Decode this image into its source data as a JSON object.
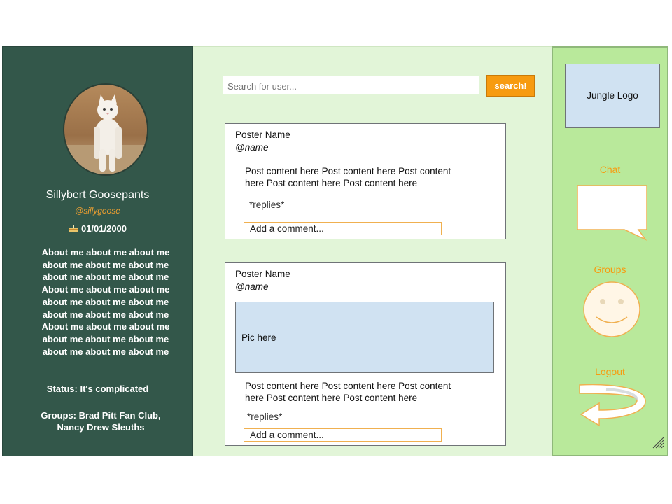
{
  "profile": {
    "display_name": "Sillybert Goosepants",
    "handle": "@sillygoose",
    "birthday": "01/01/2000",
    "about_lines": [
      "About me about me about me",
      "about me about me about me",
      "about me about me about me",
      "About me about me about me",
      "about me about me about me",
      "about me about me about me",
      "About me about me about me",
      "about me about me about me",
      "about me about me about me"
    ],
    "status": "Status: It's complicated",
    "groups_line1": "Groups: Brad Pitt Fan Club,",
    "groups_line2": "Nancy Drew Sleuths",
    "birthday_icon": "cake-icon"
  },
  "search": {
    "placeholder": "Search for user...",
    "button_label": "search!"
  },
  "posts": [
    {
      "poster_name": "Poster Name",
      "poster_handle": "@name",
      "content_line1": "Post content here Post content here Post content",
      "content_line2": "here Post content here Post content here",
      "replies": "*replies*",
      "comment_placeholder": "Add a comment..."
    },
    {
      "poster_name": "Poster Name",
      "poster_handle": "@name",
      "pic_label": "Pic here",
      "content_line1": "Post content here Post content here Post content",
      "content_line2": "here Post content here Post content here",
      "replies": "*replies*",
      "comment_placeholder": "Add a comment..."
    }
  ],
  "sidebar": {
    "logo_text": "Jungle Logo",
    "chat_label": "Chat",
    "groups_label": "Groups",
    "logout_label": "Logout",
    "icons": [
      "chat-bubble-icon",
      "smiley-icon",
      "logout-arrow-icon",
      "resize-handle-icon"
    ]
  },
  "colors": {
    "left_panel": "#33574a",
    "feed_background": "#e2f5d8",
    "sidebar_background": "#b9e99b",
    "accent_orange": "#f79b10",
    "placeholder_blue": "#d0e2f2"
  }
}
